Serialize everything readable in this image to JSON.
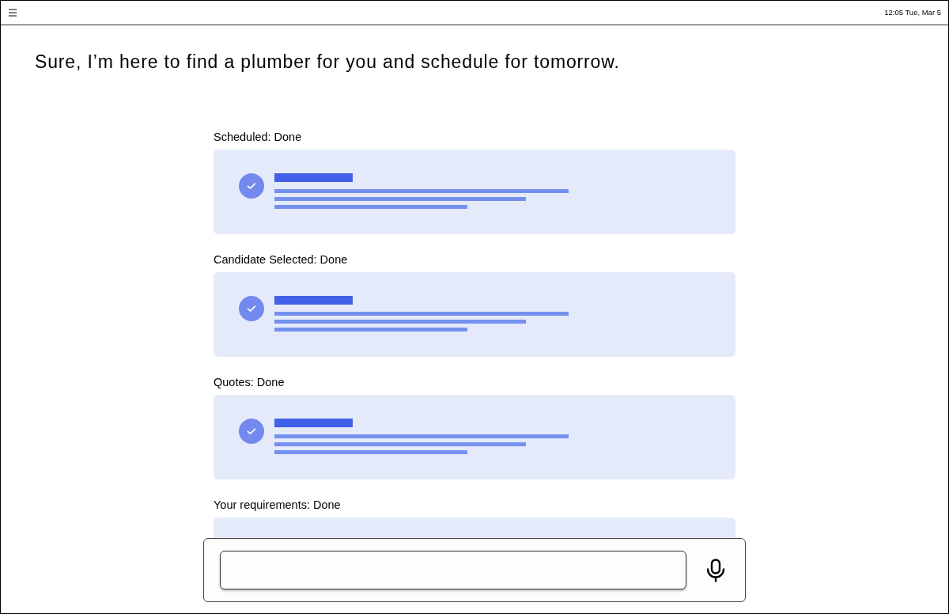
{
  "top_bar": {
    "clock": "12:05 Tue, Mar 5"
  },
  "message": "Sure, I’m here to find a plumber for you and schedule for tomorrow.",
  "sections": [
    {
      "label": "Scheduled: Done",
      "kind": "result"
    },
    {
      "label": "Candidate Selected: Done",
      "kind": "result"
    },
    {
      "label": "Quotes: Done",
      "kind": "result"
    },
    {
      "label": "Your requirements: Done",
      "kind": "clipped"
    }
  ]
}
